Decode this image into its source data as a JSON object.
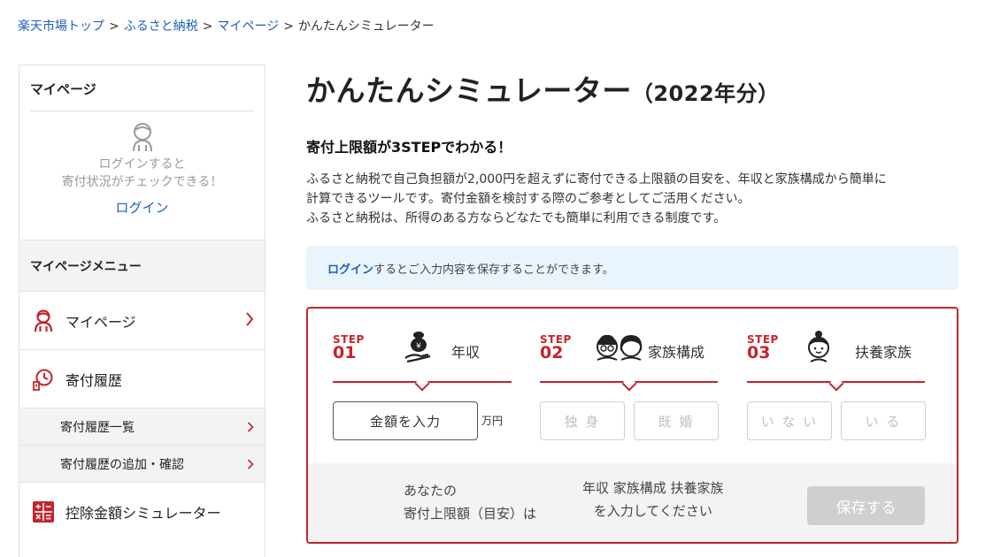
{
  "breadcrumb": {
    "items": [
      "楽天市場トップ",
      "ふるさと納税",
      "マイページ"
    ],
    "current": "かんたんシミュレーター",
    "separator": ">"
  },
  "sidebar": {
    "title": "マイページ",
    "login_text_1": "ログインすると",
    "login_text_2": "寄付状況がチェックできる！",
    "login_link": "ログイン",
    "menu_head": "マイページメニュー",
    "items": [
      {
        "label": "マイページ",
        "icon": "person-icon"
      },
      {
        "label": "寄付履歴",
        "icon": "donation-history-icon"
      },
      {
        "label": "寄付履歴一覧"
      },
      {
        "label": "寄付履歴の追加・確認"
      },
      {
        "label": "控除金額シミュレーター",
        "icon": "calculator-icon"
      }
    ]
  },
  "main": {
    "title": "かんたんシミュレーター",
    "title_year": "（2022年分）",
    "subheading": "寄付上限額が3STEPでわかる！",
    "description": [
      "ふるさと納税で自己負担額が2,000円を超えずに寄付できる上限額の目安を、年収と家族構成から簡単に",
      "計算できるツールです。寄付金額を検討する際のご参考としてご活用ください。",
      "ふるさと納税は、所得のある方ならどなたでも簡単に利用できる制度です。"
    ],
    "notice_link": "ログイン",
    "notice_text": "するとご入力内容を保存することができます。"
  },
  "simulator": {
    "step_word": "STEP",
    "steps": [
      {
        "num": "01",
        "name": "年収",
        "icon": "money-bag-icon"
      },
      {
        "num": "02",
        "name": "家族構成",
        "icon": "couple-icon"
      },
      {
        "num": "03",
        "name": "扶養家族",
        "icon": "child-icon"
      }
    ],
    "amount_button": "金額を入力",
    "unit": "万円",
    "single": "独 身",
    "married": "既 婚",
    "no_dependents": "い な い",
    "has_dependents": "い る",
    "result_label_1": "あなたの",
    "result_label_2": "寄付上限額（目安）は",
    "result_prompt_1": "年収 家族構成 扶養家族",
    "result_prompt_2": "を入力してください",
    "save_button": "保存する"
  },
  "colors": {
    "accent": "#c4242c",
    "link": "#1d5fb8",
    "notice_bg": "#eaf4fc",
    "disabled": "#cfcfcf"
  }
}
